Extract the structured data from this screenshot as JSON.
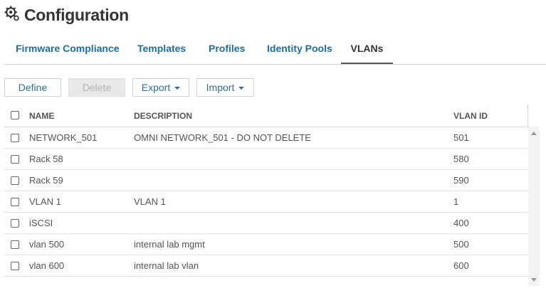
{
  "header": {
    "title": "Configuration",
    "icon": "gears-icon"
  },
  "tabs": [
    {
      "label": "Firmware Compliance",
      "active": false
    },
    {
      "label": "Templates",
      "active": false
    },
    {
      "label": "Profiles",
      "active": false
    },
    {
      "label": "Identity Pools",
      "active": false
    },
    {
      "label": "VLANs",
      "active": true
    }
  ],
  "toolbar": {
    "define": "Define",
    "delete": "Delete",
    "export": "Export",
    "import": "Import"
  },
  "table": {
    "columns": [
      "NAME",
      "DESCRIPTION",
      "VLAN ID"
    ],
    "rows": [
      {
        "name": "NETWORK_501",
        "description": "OMNI NETWORK_501 - DO NOT DELETE",
        "vlan_id": "501"
      },
      {
        "name": "Rack 58",
        "description": "",
        "vlan_id": "580"
      },
      {
        "name": "Rack 59",
        "description": "",
        "vlan_id": "590"
      },
      {
        "name": "VLAN 1",
        "description": "VLAN 1",
        "vlan_id": "1"
      },
      {
        "name": "iSCSI",
        "description": "",
        "vlan_id": "400"
      },
      {
        "name": "vlan 500",
        "description": "internal lab mgmt",
        "vlan_id": "500"
      },
      {
        "name": "vlan 600",
        "description": "internal lab vlan",
        "vlan_id": "600"
      }
    ]
  },
  "colors": {
    "link": "#1a6fa8",
    "button_text": "#2b6f99",
    "disabled_bg": "#e8e8e8"
  }
}
